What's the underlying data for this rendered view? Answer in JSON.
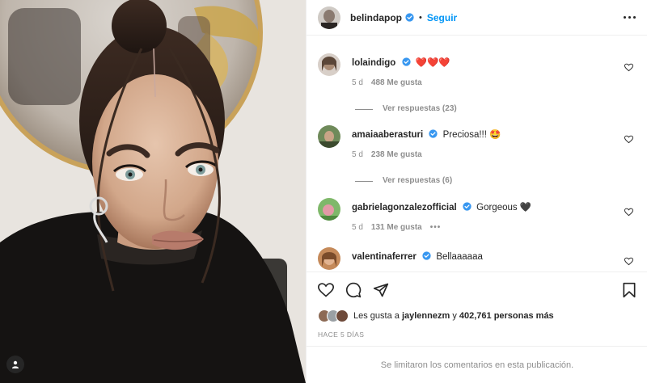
{
  "post": {
    "author": "belindapop",
    "follow_label": "Seguir",
    "dot": "•",
    "likes_prefix": "Les gusta a",
    "likes_user": "jaylennezm",
    "likes_connector": "y",
    "likes_count": "402,761 personas más",
    "date": "HACE 5 DÍAS",
    "comments_limited": "Se limitaron los comentarios en esta publicación."
  },
  "comments": [
    {
      "user": "lolaindigo",
      "text": "❤️❤️❤️",
      "time": "5 d",
      "likes": "488 Me gusta",
      "replies": "Ver respuestas (23)"
    },
    {
      "user": "amaiaaberasturi",
      "text": "Preciosa!!! 🤩",
      "time": "5 d",
      "likes": "238 Me gusta",
      "replies": "Ver respuestas (6)"
    },
    {
      "user": "gabrielagonzalezofficial",
      "text": "Gorgeous 🖤",
      "time": "5 d",
      "likes": "131 Me gusta",
      "more": "•••"
    },
    {
      "user": "valentinaferrer",
      "text": "Bellaaaaaa"
    }
  ],
  "colors": {
    "accent": "#0095f6",
    "text": "#262626",
    "muted": "#8e8e8e",
    "verified": "#3897f0",
    "heart": "#ed4956"
  },
  "icons": [
    "verified-badge-icon",
    "more-options-icon",
    "heart-icon",
    "comment-icon",
    "share-icon",
    "save-icon",
    "user-tag-icon"
  ]
}
